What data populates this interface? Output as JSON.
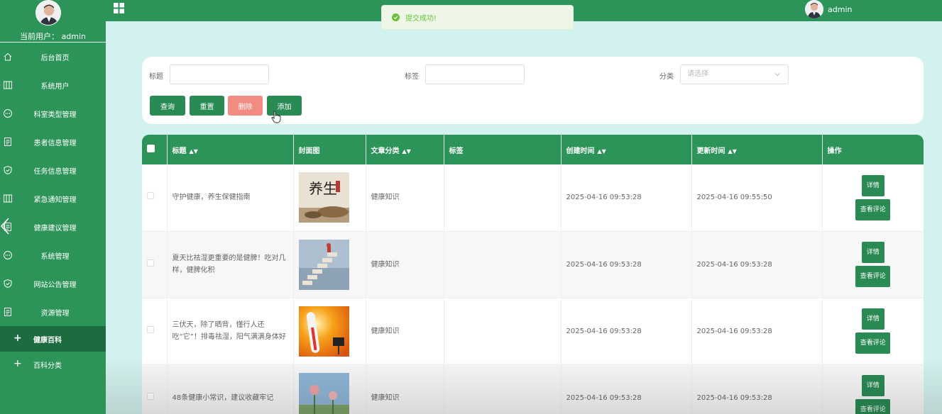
{
  "sidebar": {
    "current_user": "当前用户：  admin",
    "items": [
      {
        "label": "后台首页",
        "icon": "home-icon"
      },
      {
        "label": "系统用户",
        "icon": "columns-icon"
      },
      {
        "label": "科室类型管理",
        "icon": "chat-icon"
      },
      {
        "label": "患者信息管理",
        "icon": "document-icon"
      },
      {
        "label": "任务信息管理",
        "icon": "shield-check-icon"
      },
      {
        "label": "紧急通知管理",
        "icon": "columns-icon"
      },
      {
        "label": "健康建议管理",
        "icon": "document-icon"
      },
      {
        "label": "系统管理",
        "icon": "chat-icon"
      },
      {
        "label": "网站公告管理",
        "icon": "shield-check-icon"
      },
      {
        "label": "资源管理",
        "icon": "document-icon"
      }
    ],
    "subitems": [
      {
        "label": "健康百科",
        "active": true
      },
      {
        "label": "百科分类",
        "active": false
      }
    ]
  },
  "topbar": {
    "title": "",
    "username": "admin"
  },
  "toast": {
    "message": "提交成功!",
    "color": "#67c23a"
  },
  "search": {
    "title_label": "标题",
    "tag_label": "标签",
    "category_label": "分类",
    "category_placeholder": "请选择",
    "buttons": {
      "query": "查询",
      "reset": "重置",
      "delete": "删除",
      "add": "添加"
    }
  },
  "table": {
    "headers": {
      "title": "标题",
      "cover": "封面图",
      "category": "文章分类",
      "tag": "标签",
      "created": "创建时间",
      "updated": "更新时间",
      "ops": "操作"
    },
    "rows": [
      {
        "title": "守护健康，养生保健指南",
        "cover": "yangsheng-cover",
        "category": "健康知识",
        "tag": "",
        "created": "2025-04-16 09:53:28",
        "updated": "2025-04-16 09:55:50"
      },
      {
        "title": "夏天比祛湿更重要的是健脾！吃对几样，健脾化积",
        "cover": "stairs-cover",
        "category": "健康知识",
        "tag": "",
        "created": "2025-04-16 09:53:28",
        "updated": "2025-04-16 09:53:28"
      },
      {
        "title": "三伏天，除了晒背，懂行人还吃“它”！排毒祛湿，阳气满满身体好",
        "cover": "thermometer-cover",
        "category": "健康知识",
        "tag": "",
        "created": "2025-04-16 09:53:28",
        "updated": "2025-04-16 09:53:28"
      },
      {
        "title": "48条健康小常识，建议收藏牢记",
        "cover": "flower-cover",
        "category": "健康知识",
        "tag": "",
        "created": "2025-04-16 09:53:28",
        "updated": "2025-04-16 09:53:28"
      }
    ],
    "detail_label": "详情",
    "comments_label": "查看评论"
  },
  "colors": {
    "brand": "#2c9458",
    "background": "#d3f1ee",
    "danger": "#f28b82"
  }
}
